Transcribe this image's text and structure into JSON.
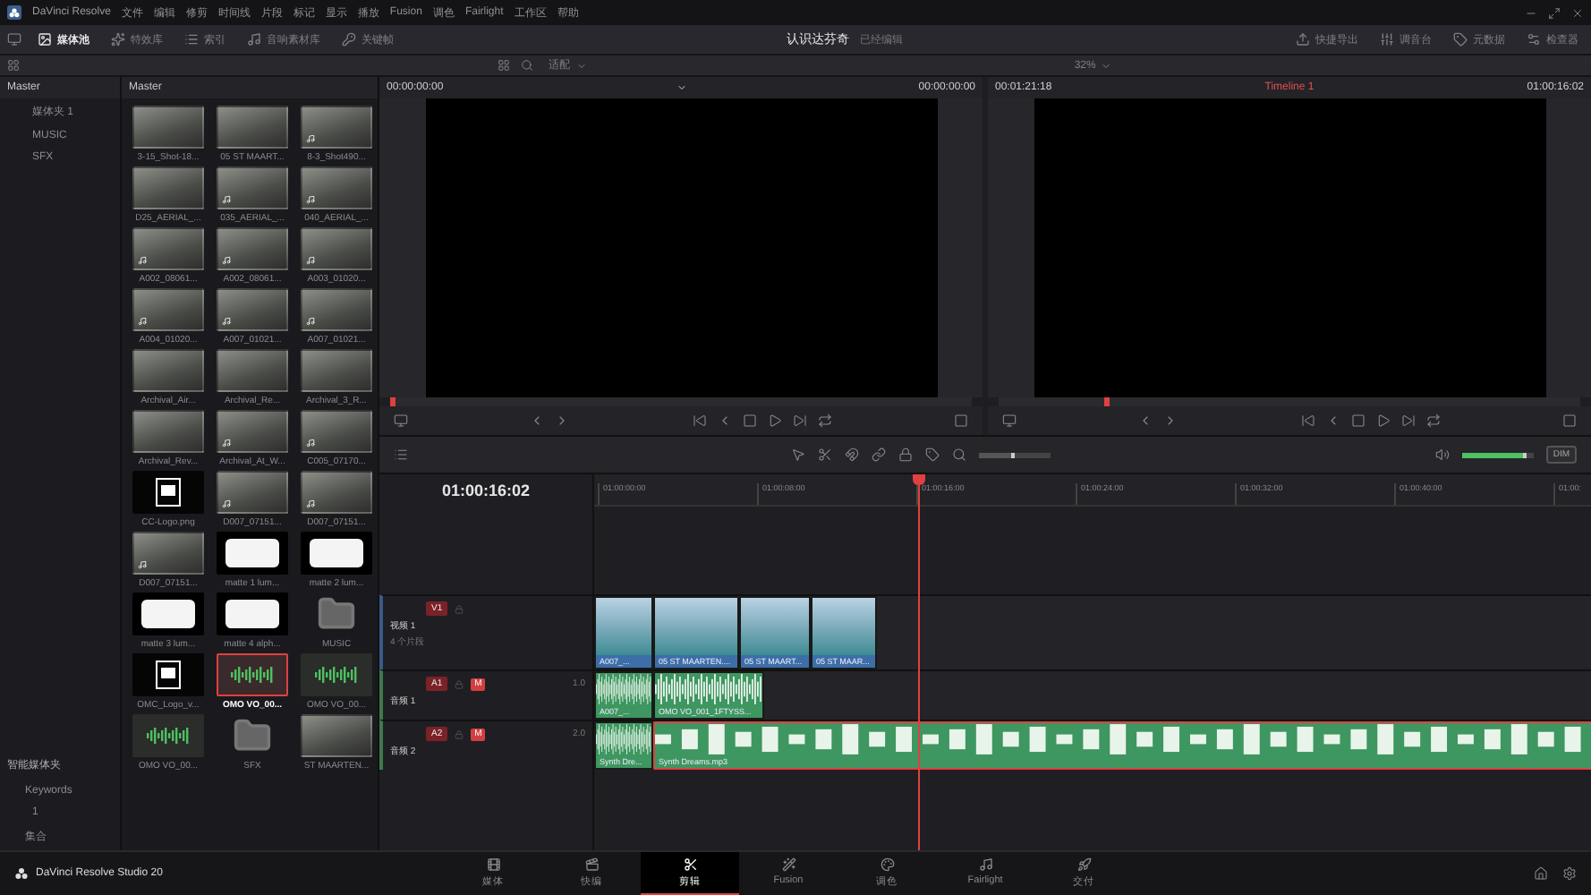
{
  "title_bar": {
    "app": "DaVinci Resolve",
    "menu": [
      "文件",
      "编辑",
      "修剪",
      "时间线",
      "片段",
      "标记",
      "显示",
      "播放",
      "Fusion",
      "调色",
      "Fairlight",
      "工作区",
      "帮助"
    ]
  },
  "toolbar": {
    "left": [
      {
        "label": "媒体池",
        "selected": true
      },
      {
        "label": "特效库",
        "selected": false
      },
      {
        "label": "索引",
        "selected": false
      },
      {
        "label": "音响素材库",
        "selected": false
      },
      {
        "label": "关键帧",
        "selected": false
      }
    ],
    "project": "认识达芬奇",
    "status": "已经编辑",
    "right": [
      "快捷导出",
      "调音台",
      "元数据",
      "检查器"
    ]
  },
  "toolbar2": {
    "fit": "适配",
    "zoom": "32%"
  },
  "sidebar": {
    "title": "Master",
    "items": [
      "媒体夹 1",
      "MUSIC",
      "SFX"
    ],
    "smart_bins": "智能媒体夹",
    "keywords": "Keywords",
    "keyword_items": [
      "1"
    ],
    "collections": "集合"
  },
  "media_pool": {
    "title": "Master",
    "items": [
      {
        "name": "3-15_Shot-18...",
        "kind": "video",
        "with_audio": false,
        "selected": false
      },
      {
        "name": "05 ST MAART...",
        "kind": "video",
        "with_audio": false,
        "selected": false
      },
      {
        "name": "8-3_Shot490...",
        "kind": "video",
        "with_audio": true,
        "selected": false
      },
      {
        "name": "D25_AERIAL_...",
        "kind": "video",
        "with_audio": false,
        "selected": false
      },
      {
        "name": "035_AERIAL_...",
        "kind": "video",
        "with_audio": true,
        "selected": false
      },
      {
        "name": "040_AERIAL_...",
        "kind": "video",
        "with_audio": true,
        "selected": false
      },
      {
        "name": "A002_08061...",
        "kind": "video",
        "with_audio": true,
        "selected": false
      },
      {
        "name": "A002_08061...",
        "kind": "video",
        "with_audio": true,
        "selected": false
      },
      {
        "name": "A003_01020...",
        "kind": "video",
        "with_audio": true,
        "selected": false
      },
      {
        "name": "A004_01020...",
        "kind": "video",
        "with_audio": true,
        "selected": false
      },
      {
        "name": "A007_01021...",
        "kind": "video",
        "with_audio": true,
        "selected": false
      },
      {
        "name": "A007_01021...",
        "kind": "video",
        "with_audio": true,
        "selected": false
      },
      {
        "name": "Archival_Air...",
        "kind": "video",
        "with_audio": false,
        "selected": false
      },
      {
        "name": "Archival_Re...",
        "kind": "video",
        "with_audio": false,
        "selected": false
      },
      {
        "name": "Archival_3_R...",
        "kind": "video",
        "with_audio": false,
        "selected": false
      },
      {
        "name": "Archival_Rev...",
        "kind": "video",
        "with_audio": false,
        "selected": false
      },
      {
        "name": "Archival_At_W...",
        "kind": "video",
        "with_audio": true,
        "selected": false
      },
      {
        "name": "C005_07170...",
        "kind": "video",
        "with_audio": true,
        "selected": false
      },
      {
        "name": "CC-Logo.png",
        "kind": "image",
        "with_audio": false,
        "selected": false
      },
      {
        "name": "D007_07151...",
        "kind": "video",
        "with_audio": true,
        "selected": false
      },
      {
        "name": "D007_07151...",
        "kind": "video",
        "with_audio": true,
        "selected": false
      },
      {
        "name": "D007_07151...",
        "kind": "video",
        "with_audio": true,
        "selected": false
      },
      {
        "name": "matte 1 lum...",
        "kind": "matte",
        "with_audio": false,
        "selected": false
      },
      {
        "name": "matte 2 lum...",
        "kind": "matte",
        "with_audio": false,
        "selected": false
      },
      {
        "name": "matte 3 lum...",
        "kind": "matte",
        "with_audio": false,
        "selected": false
      },
      {
        "name": "matte 4 alph...",
        "kind": "matte",
        "with_audio": false,
        "selected": false
      },
      {
        "name": "MUSIC",
        "kind": "folder",
        "with_audio": false,
        "selected": false
      },
      {
        "name": "OMC_Logo_v...",
        "kind": "image",
        "with_audio": false,
        "selected": false
      },
      {
        "name": "OMO VO_00...",
        "kind": "audio",
        "with_audio": false,
        "selected": true
      },
      {
        "name": "OMO VO_00...",
        "kind": "audio",
        "with_audio": false,
        "selected": false
      },
      {
        "name": "OMO VO_00...",
        "kind": "audio",
        "with_audio": false,
        "selected": false
      },
      {
        "name": "SFX",
        "kind": "folder",
        "with_audio": false,
        "selected": false
      },
      {
        "name": "ST MAARTEN...",
        "kind": "video",
        "with_audio": false,
        "selected": false
      }
    ]
  },
  "source_viewer": {
    "timecode": "00:00:00:00",
    "position": "00:00:00:00",
    "scrub": {
      "level": 0
    }
  },
  "program_viewer": {
    "duration": "00:01:21:18",
    "timeline_name": "Timeline 1",
    "timecode": "01:00:16:02",
    "scrub": {
      "level": 0.19
    }
  },
  "timeline": {
    "timecode": "01:00:16:02",
    "zoom": {
      "level": 0.5
    },
    "volume": {
      "level": 0.9
    },
    "dim": "DIM",
    "ruler": [
      "01:00:00:00",
      "01:00:08:00",
      "01:00:16:00",
      "01:00:24:00",
      "01:00:32:00",
      "01:00:40:00",
      "01:00:"
    ],
    "tracks": [
      {
        "id": "V1",
        "kind": "video",
        "name": "视频 1",
        "info": "4 个片段",
        "clips": [
          {
            "name": "A007_...",
            "selected": false
          },
          {
            "name": "05 ST MAARTEN....",
            "selected": false
          },
          {
            "name": "05 ST MAART...",
            "selected": false
          },
          {
            "name": "05 ST MAAR...",
            "selected": false
          }
        ]
      },
      {
        "id": "A1",
        "kind": "audio",
        "name": "音频 1",
        "mute": "M",
        "volume": "1.0",
        "clips": [
          {
            "name": "A007_...",
            "selected": false
          },
          {
            "name": "OMO VO_001_1FTYSS...",
            "selected": false
          }
        ]
      },
      {
        "id": "A2",
        "kind": "audio",
        "name": "音频 2",
        "mute": "M",
        "volume": "2.0",
        "clips": [
          {
            "name": "Synth Dre...",
            "selected": false
          },
          {
            "name": "Synth Dreams.mp3",
            "selected": true
          }
        ]
      }
    ]
  },
  "pages": [
    {
      "label": "媒体",
      "selected": false
    },
    {
      "label": "快编",
      "selected": false
    },
    {
      "label": "剪辑",
      "selected": true
    },
    {
      "label": "Fusion",
      "selected": false
    },
    {
      "label": "调色",
      "selected": false
    },
    {
      "label": "Fairlight",
      "selected": false
    },
    {
      "label": "交付",
      "selected": false
    }
  ],
  "footer": "DaVinci Resolve Studio 20"
}
